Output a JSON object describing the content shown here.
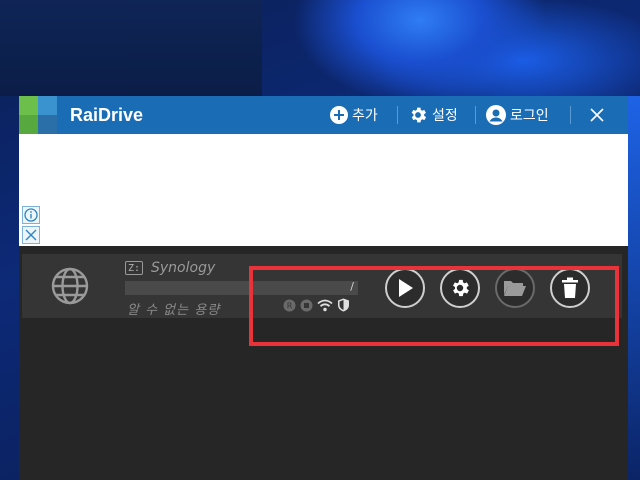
{
  "app": {
    "title": "RaiDrive"
  },
  "toolbar": {
    "add_label": "추가",
    "settings_label": "설정",
    "login_label": "로그인"
  },
  "drive": {
    "letter": "Z:",
    "name": "Synology",
    "usage_text": "알 수 없는 용량",
    "usage_separator": "/",
    "usage_fraction": 0,
    "status_icons": [
      "readonly-icon",
      "disconnected-icon",
      "wifi-icon",
      "shield-icon"
    ],
    "actions": [
      "play-icon",
      "gear-icon",
      "folder-icon",
      "trash-icon"
    ]
  },
  "colors": {
    "titlebar": "#1a6db5",
    "accent_green": "#6cbf4a",
    "highlight": "#e8333b",
    "background": "#262626"
  }
}
